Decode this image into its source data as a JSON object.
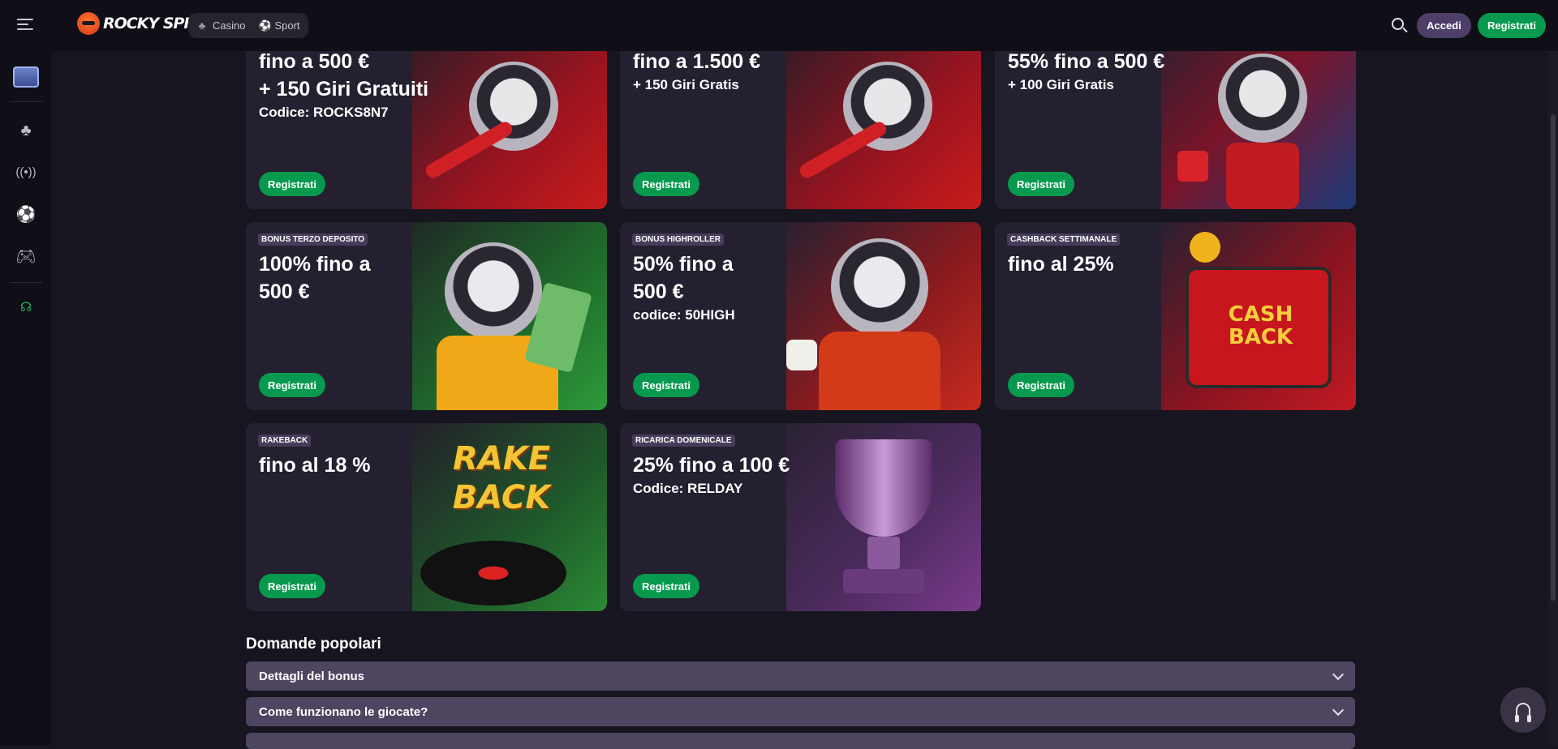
{
  "header": {
    "logo_text": "ROCKY SPIN",
    "nav": [
      {
        "label": "Casino",
        "icon": "cherries-icon"
      },
      {
        "label": "Sport",
        "icon": "ball-icon"
      }
    ],
    "login_label": "Accedi",
    "register_label": "Registrati"
  },
  "sidebar": {
    "items": [
      "chest-icon",
      "cherries-icon",
      "live-broadcast-icon",
      "football-icon",
      "gamepad-icon",
      "support-headset-icon"
    ]
  },
  "bonuses": [
    {
      "badge": "",
      "title": "fino a 500 €",
      "subtitle_big": "+ 150 Giri Gratuiti",
      "subtitle": "Codice: ROCKS8N7",
      "cta": "Registrati",
      "art": "raccoon-guitar"
    },
    {
      "badge": "",
      "title": "fino a 1.500 €",
      "subtitle_big": "",
      "subtitle": "+ 150 Giri Gratis",
      "cta": "Registrati",
      "art": "raccoon-guitar"
    },
    {
      "badge": "",
      "title": "55% fino a 500 €",
      "subtitle_big": "",
      "subtitle": "+ 100 Giri Gratis",
      "cta": "Registrati",
      "art": "raccoon-dice"
    },
    {
      "badge": "BONUS TERZO DEPOSITO",
      "title": "100% fino a 500 €",
      "subtitle_big": "",
      "subtitle": "",
      "cta": "Registrati",
      "art": "raccoon-cash"
    },
    {
      "badge": "BONUS HIGHROLLER",
      "title": "50% fino a 500 €",
      "subtitle_big": "",
      "subtitle": "codice: 50HIGH",
      "cta": "Registrati",
      "art": "raccoon-jacket"
    },
    {
      "badge": "CASHBACK SETTIMANALE",
      "title": "fino al 25%",
      "subtitle_big": "",
      "subtitle": "",
      "cta": "Registrati",
      "art": "cashback-box"
    },
    {
      "badge": "RAKEBACK",
      "title": "fino al 18 %",
      "subtitle_big": "",
      "subtitle": "",
      "cta": "Registrati",
      "art": "rakeback-vinyl"
    },
    {
      "badge": "RICARICA DOMENICALE",
      "title": "25% fino a 100 €",
      "subtitle_big": "",
      "subtitle": "Codice: RELDAY",
      "cta": "Registrati",
      "art": "trophy"
    }
  ],
  "faq": {
    "title": "Domande popolari",
    "items": [
      "Dettagli del bonus",
      "Come funzionano le giocate?"
    ]
  },
  "colors": {
    "accent_green": "#079a4e",
    "accent_purple": "#4e3f68",
    "background": "#17151f",
    "card": "#242030"
  }
}
